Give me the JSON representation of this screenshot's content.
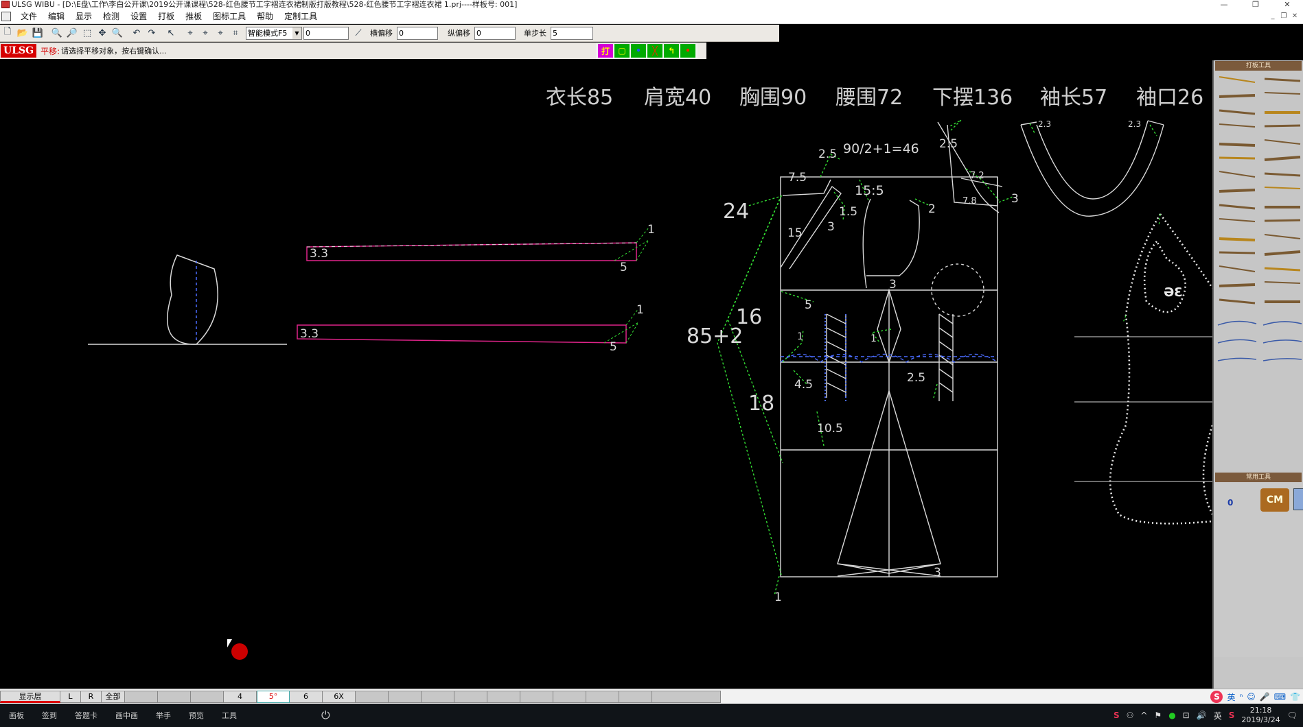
{
  "window": {
    "title": "ULSG WIBU - [D:\\E盘\\工作\\李白公开课\\2019公开课课程\\528-红色腰节工字褶连衣裙制版打版教程\\528-红色腰节工字褶连衣裙 1.prj----样板号: 001]",
    "controls": [
      "—",
      "❐",
      "✕"
    ]
  },
  "menu": {
    "items": [
      "文件",
      "编辑",
      "显示",
      "检测",
      "设置",
      "打板",
      "推板",
      "图标工具",
      "帮助",
      "定制工具"
    ],
    "mdi_controls": [
      "_",
      "❐",
      "✕"
    ]
  },
  "toolbar": {
    "mode_select": "智能模式F5",
    "value_input": "0",
    "horizontal_offset_label": "横偏移",
    "horizontal_offset_value": "0",
    "vertical_offset_label": "纵偏移",
    "vertical_offset_value": "0",
    "step_label": "单步长",
    "step_value": "5"
  },
  "prompt": {
    "logo": "ULSG",
    "command": "平移:",
    "message": "请选择平移对象，按右键确认..."
  },
  "mode_buttons": [
    {
      "label": "打",
      "bg": "#d400d4",
      "color": "#ffff00"
    },
    {
      "label": "▢",
      "bg": "#00aa00",
      "color": "#ffff00"
    },
    {
      "label": "•",
      "bg": "#00aa00",
      "color": "#2255ff"
    },
    {
      "label": "╳",
      "bg": "#00aa00",
      "color": "#ff2200"
    },
    {
      "label": "↰",
      "bg": "#00aa00",
      "color": "#ffff00"
    },
    {
      "label": "•",
      "bg": "#00aa00",
      "color": "#ff2200"
    }
  ],
  "measurements": [
    "衣长85",
    "肩宽40",
    "胸围90",
    "腰围72",
    "下摆136",
    "袖长57",
    "袖口26"
  ],
  "canvas_labels": {
    "strip1_left": "3.3",
    "strip1_right": "1",
    "strip1_bottom": "5",
    "strip2_left": "3.3",
    "strip2_right": "1",
    "strip2_bottom": "5",
    "formula": "90/2+1=46",
    "n24": "24",
    "n16": "16",
    "n18": "18",
    "n85": "85+2",
    "n7_5": "7.5",
    "n15_5": "15:5",
    "n2_5a": "2.5",
    "n2_5b": "2.5",
    "n1_5": "1.5",
    "n15": "15",
    "n3a": "3",
    "n2": "2",
    "n7_2": "7.2",
    "n7_8": "7.8",
    "n3b": "3",
    "n3c": "3",
    "n5": "5",
    "n4_5": "4.5",
    "n2_5c": "2.5",
    "n10_5": "10.5",
    "n1a": "1",
    "n1b": "1",
    "n3d": "3",
    "n1c": "1",
    "n2_3a": "2.3",
    "n2_3b": "2.3",
    "sleeve_mark": "ƏƐ"
  },
  "right_panel": {
    "header1": "打板工具",
    "header2": "常用工具",
    "zero": "0",
    "cm": "CM"
  },
  "layerbar": {
    "cells": [
      "显示层",
      "L",
      "R",
      "全部",
      "",
      "",
      "",
      "4",
      "5°",
      "6",
      "6X",
      "",
      "",
      "",
      "",
      "",
      "",
      "",
      "",
      "",
      ""
    ],
    "ime": [
      "英",
      "ⁿ",
      "☺",
      "🎤",
      "⌨",
      "👕"
    ]
  },
  "taskbar": {
    "items": [
      "画板",
      "签到",
      "答题卡",
      "画中画",
      "举手",
      "预览",
      "工具"
    ],
    "tray": [
      "S",
      "⚇",
      "^",
      "⚑",
      "●",
      "⊡",
      "🔊",
      "英",
      "S"
    ],
    "time": "21:18",
    "date": "2019/3/24"
  },
  "colors": {
    "pattern_line": "#d9d9d9",
    "guide_dots": "#33dd33",
    "seam_pink": "#e0248a",
    "hatch_blue": "#4a6cff",
    "canvas_bg": "#000000"
  }
}
